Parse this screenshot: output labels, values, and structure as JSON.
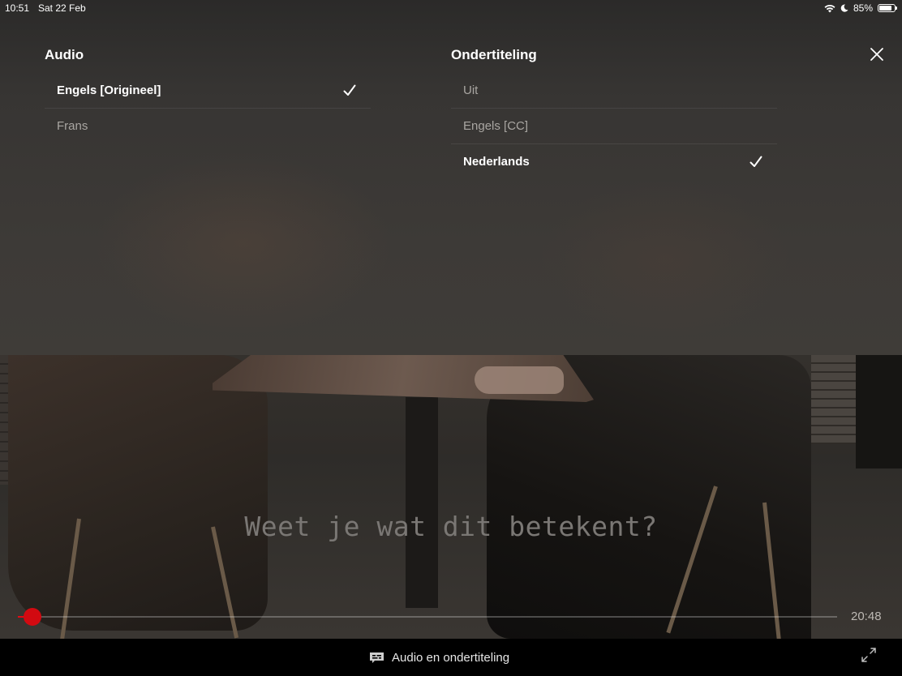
{
  "status_bar": {
    "time": "10:51",
    "date": "Sat 22 Feb",
    "battery_percent": "85%",
    "battery_level": 0.85,
    "icons": [
      "wifi-icon",
      "moon-icon",
      "battery-icon"
    ]
  },
  "audio": {
    "heading": "Audio",
    "options": [
      {
        "label": "Engels [Origineel]",
        "selected": true
      },
      {
        "label": "Frans",
        "selected": false
      }
    ]
  },
  "subtitles": {
    "heading": "Ondertiteling",
    "options": [
      {
        "label": "Uit",
        "selected": false
      },
      {
        "label": "Engels [CC]",
        "selected": false
      },
      {
        "label": "Nederlands",
        "selected": true
      }
    ]
  },
  "player": {
    "subtitle_text": "Weet je wat dit betekent?",
    "time_remaining": "20:48",
    "progress_fraction": 0.018,
    "accent_color": "#e50914"
  },
  "bottom_bar": {
    "audio_subtitles_label": "Audio en ondertiteling"
  }
}
